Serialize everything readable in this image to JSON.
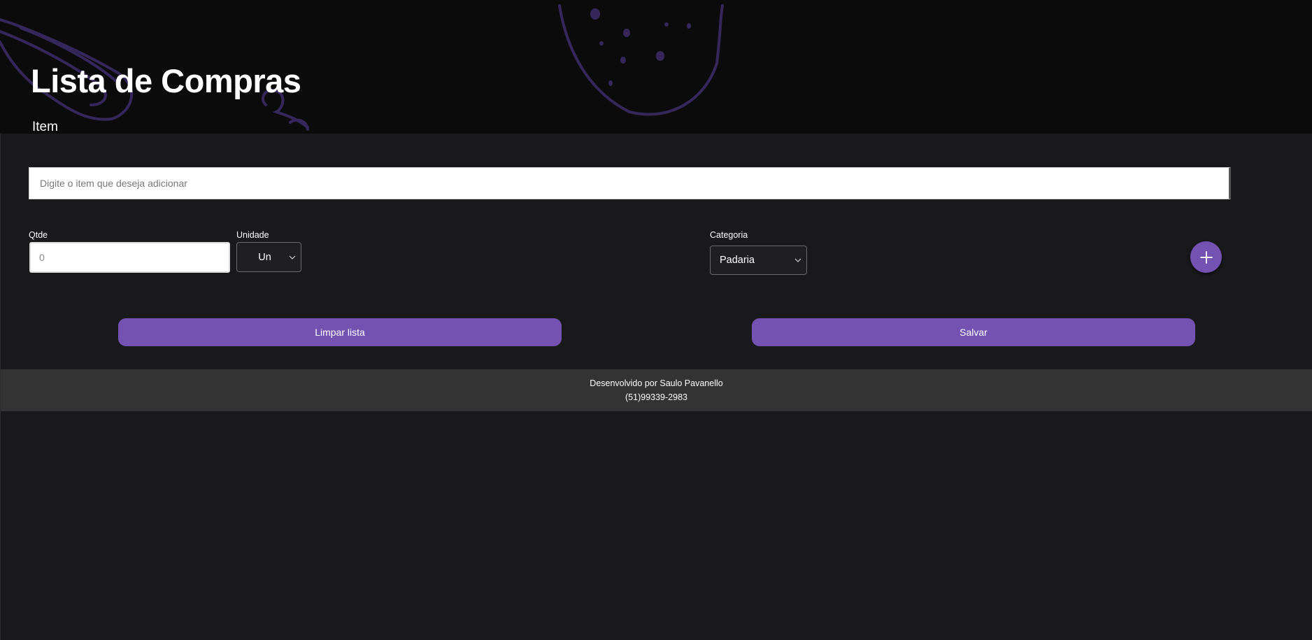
{
  "header": {
    "title": "Lista de Compras"
  },
  "form": {
    "item_label": "Item",
    "item_placeholder": "Digite o item que deseja adicionar",
    "qty_label": "Qtde",
    "qty_placeholder": "0",
    "unit_label": "Unidade",
    "unit_value": "Un",
    "category_label": "Categoria",
    "category_value": "Padaria",
    "add_icon": "plus-icon"
  },
  "actions": {
    "clear_label": "Limpar lista",
    "save_label": "Salvar"
  },
  "footer": {
    "credit": "Desenvolvido por Saulo Pavanello",
    "phone": "(51)99339-2983"
  },
  "colors": {
    "accent": "#7452b1",
    "background": "#19191c",
    "header_background": "#0b0b0c",
    "footer_background": "#333333",
    "decoration": "#3a2a5e"
  }
}
